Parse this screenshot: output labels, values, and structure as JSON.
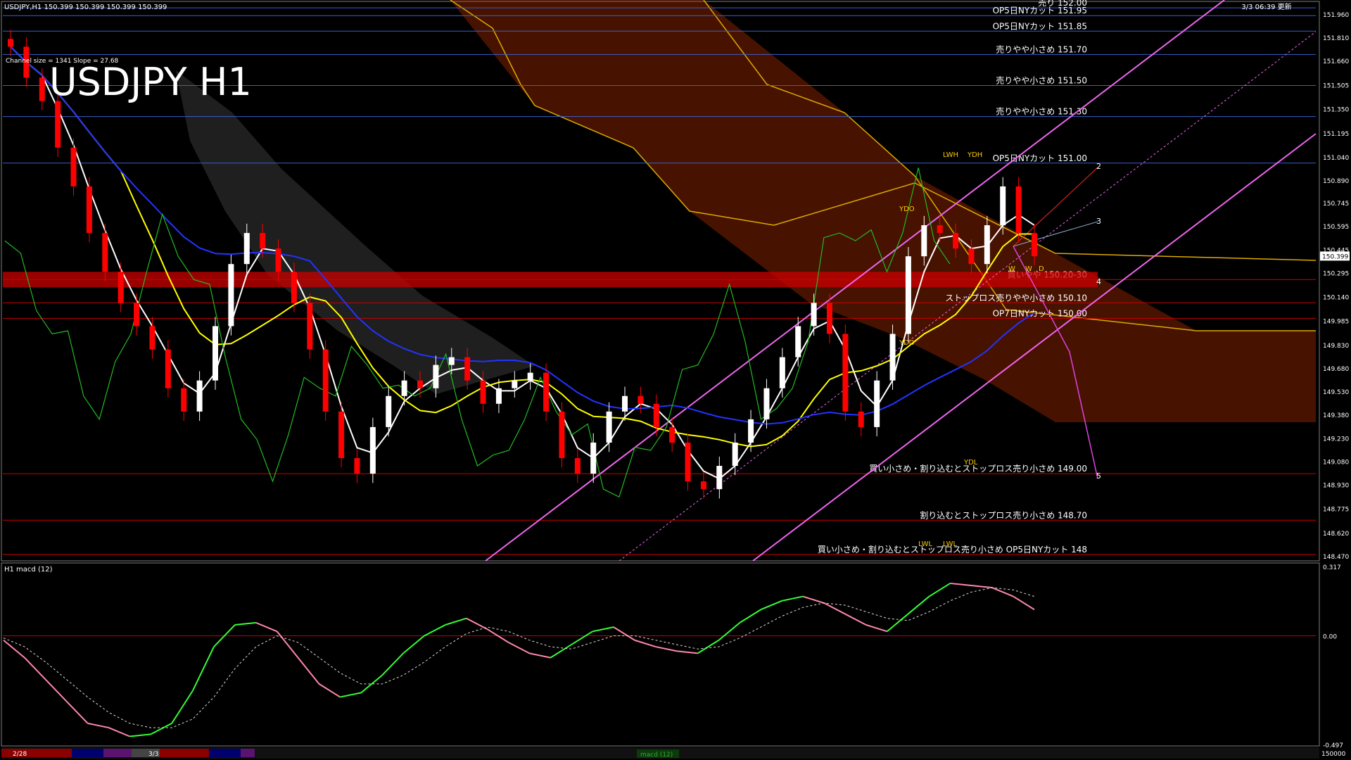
{
  "header": {
    "symbol_line": "USDJPY,H1  150.399 150.399 150.399 150.399",
    "channel_info": "Channel size = 1341 Slope = 27.68",
    "big_title": "USDJPY H1",
    "updated": "3/3 06:39 更新"
  },
  "colors": {
    "background": "#000000",
    "bull_candle": "#ffffff",
    "bear_candle": "#ff0000",
    "cloud_bear": "#cc3300",
    "cloud_bull": "#ffffff",
    "ma_white": "#ffffff",
    "ma_yellow": "#ffff00",
    "ma_blue": "#2233ff",
    "lag_line": "#22bb22",
    "channel": "#ee66ee",
    "resistance_band": "#cc0000",
    "macd_up": "#33ff33",
    "macd_down": "#ff88aa"
  },
  "chart_data": [
    {
      "type": "candlestick",
      "title": "USDJPY H1",
      "ylim": [
        148.47,
        151.96
      ],
      "y_ticks": [
        "151.960",
        "151.810",
        "151.660",
        "151.505",
        "151.350",
        "151.195",
        "151.040",
        "150.890",
        "150.745",
        "150.595",
        "150.445",
        "150.295",
        "150.140",
        "149.985",
        "149.830",
        "149.680",
        "149.530",
        "149.380",
        "149.230",
        "149.080",
        "148.930",
        "148.775",
        "148.620",
        "148.470"
      ],
      "price_label": "150.399",
      "series": [
        {
          "name": "close",
          "values": [
            151.75,
            151.55,
            151.4,
            151.1,
            150.85,
            150.55,
            150.3,
            150.1,
            149.95,
            149.8,
            149.55,
            149.4,
            149.6,
            149.95,
            150.35,
            150.55,
            150.45,
            150.3,
            150.1,
            149.8,
            149.4,
            149.1,
            149.0,
            149.3,
            149.5,
            149.6,
            149.55,
            149.7,
            149.75,
            149.6,
            149.45,
            149.55,
            149.6,
            149.65,
            149.4,
            149.1,
            149.0,
            149.2,
            149.4,
            149.5,
            149.45,
            149.3,
            149.2,
            148.95,
            148.9,
            149.05,
            149.2,
            149.35,
            149.55,
            149.75,
            149.95,
            150.1,
            149.9,
            149.4,
            149.3,
            149.6,
            149.9,
            150.4,
            150.6,
            150.55,
            150.45,
            150.35,
            150.6,
            150.85,
            150.55,
            150.4
          ]
        }
      ],
      "levels": [
        {
          "label": "売り 152.00",
          "value": 152.0,
          "color": "#ffffff"
        },
        {
          "label": "OP5日NYカット 151.95",
          "value": 151.95,
          "color": "#ffffff"
        },
        {
          "label": "OP5日NYカット 151.85",
          "value": 151.85,
          "color": "#ffffff"
        },
        {
          "label": "売りやや小さめ 151.70",
          "value": 151.7,
          "color": "#ffffff"
        },
        {
          "label": "売りやや小さめ 151.50",
          "value": 151.5,
          "color": "#ffffff"
        },
        {
          "label": "売りやや小さめ 151.30",
          "value": 151.3,
          "color": "#ffffff"
        },
        {
          "label": "OP5日NYカット 151.00",
          "value": 151.0,
          "color": "#ffffff"
        },
        {
          "label": "買いやや 150.20-30",
          "value": 150.25,
          "color": "#ffffff"
        },
        {
          "label": "ストップロス売りやや小さめ 150.10",
          "value": 150.1,
          "color": "#ffffff"
        },
        {
          "label": "OP7日NYカット 150.00",
          "value": 150.0,
          "color": "#ffffff"
        },
        {
          "label": "買い小さめ・割り込むとストップロス売り小さめ 149.00",
          "value": 149.0,
          "color": "#ffffff"
        },
        {
          "label": "割り込むとストップロス売り小さめ 148.70",
          "value": 148.7,
          "color": "#ffffff"
        },
        {
          "label": "買い小さめ・割り込むとストップロス売り小さめ OP5日NYカット 148",
          "value": 148.48,
          "color": "#ffffff"
        }
      ],
      "markers": [
        {
          "label": "YDO",
          "value": 150.55
        },
        {
          "label": "YDO",
          "value": 149.82
        },
        {
          "label": "YDL",
          "value": 149.05
        },
        {
          "label": "LWL",
          "value": 148.55
        },
        {
          "label": "LWL",
          "value": 148.55
        },
        {
          "label": "LWH",
          "value": 151.0
        },
        {
          "label": "YDH",
          "value": 151.0
        },
        {
          "label": "W",
          "value": 150.15
        },
        {
          "label": "W",
          "value": 150.15
        },
        {
          "label": "D",
          "value": 150.15
        }
      ],
      "projection_numbers": [
        "2",
        "3",
        "4",
        "5"
      ]
    },
    {
      "type": "line",
      "title": "H1  macd (12)",
      "ylim": [
        -0.497,
        0.317
      ],
      "y_ticks": [
        "0.317",
        "0.00",
        "-0.497"
      ],
      "zero_line": "0.00",
      "series": [
        {
          "name": "macd",
          "values": [
            -0.02,
            -0.1,
            -0.2,
            -0.3,
            -0.4,
            -0.42,
            -0.46,
            -0.45,
            -0.4,
            -0.25,
            -0.05,
            0.05,
            0.06,
            0.02,
            -0.1,
            -0.22,
            -0.28,
            -0.26,
            -0.18,
            -0.08,
            0.0,
            0.05,
            0.08,
            0.03,
            -0.03,
            -0.08,
            -0.1,
            -0.04,
            0.02,
            0.04,
            -0.02,
            -0.05,
            -0.07,
            -0.08,
            -0.02,
            0.06,
            0.12,
            0.16,
            0.18,
            0.15,
            0.1,
            0.05,
            0.02,
            0.1,
            0.18,
            0.24,
            0.23,
            0.22,
            0.18,
            0.12
          ]
        },
        {
          "name": "signal",
          "values": [
            -0.01,
            -0.05,
            -0.12,
            -0.2,
            -0.28,
            -0.35,
            -0.4,
            -0.42,
            -0.42,
            -0.38,
            -0.28,
            -0.15,
            -0.05,
            0.0,
            -0.03,
            -0.1,
            -0.17,
            -0.22,
            -0.22,
            -0.18,
            -0.12,
            -0.05,
            0.01,
            0.04,
            0.02,
            -0.02,
            -0.05,
            -0.06,
            -0.03,
            0.0,
            0.0,
            -0.02,
            -0.04,
            -0.06,
            -0.05,
            -0.01,
            0.04,
            0.09,
            0.13,
            0.15,
            0.14,
            0.11,
            0.08,
            0.07,
            0.11,
            0.16,
            0.2,
            0.22,
            0.21,
            0.18
          ]
        }
      ]
    }
  ],
  "bottom_bar": {
    "date_labels": [
      "2/28",
      "3/3"
    ],
    "macd_tag": "macd (12)",
    "right_value": "150000"
  }
}
